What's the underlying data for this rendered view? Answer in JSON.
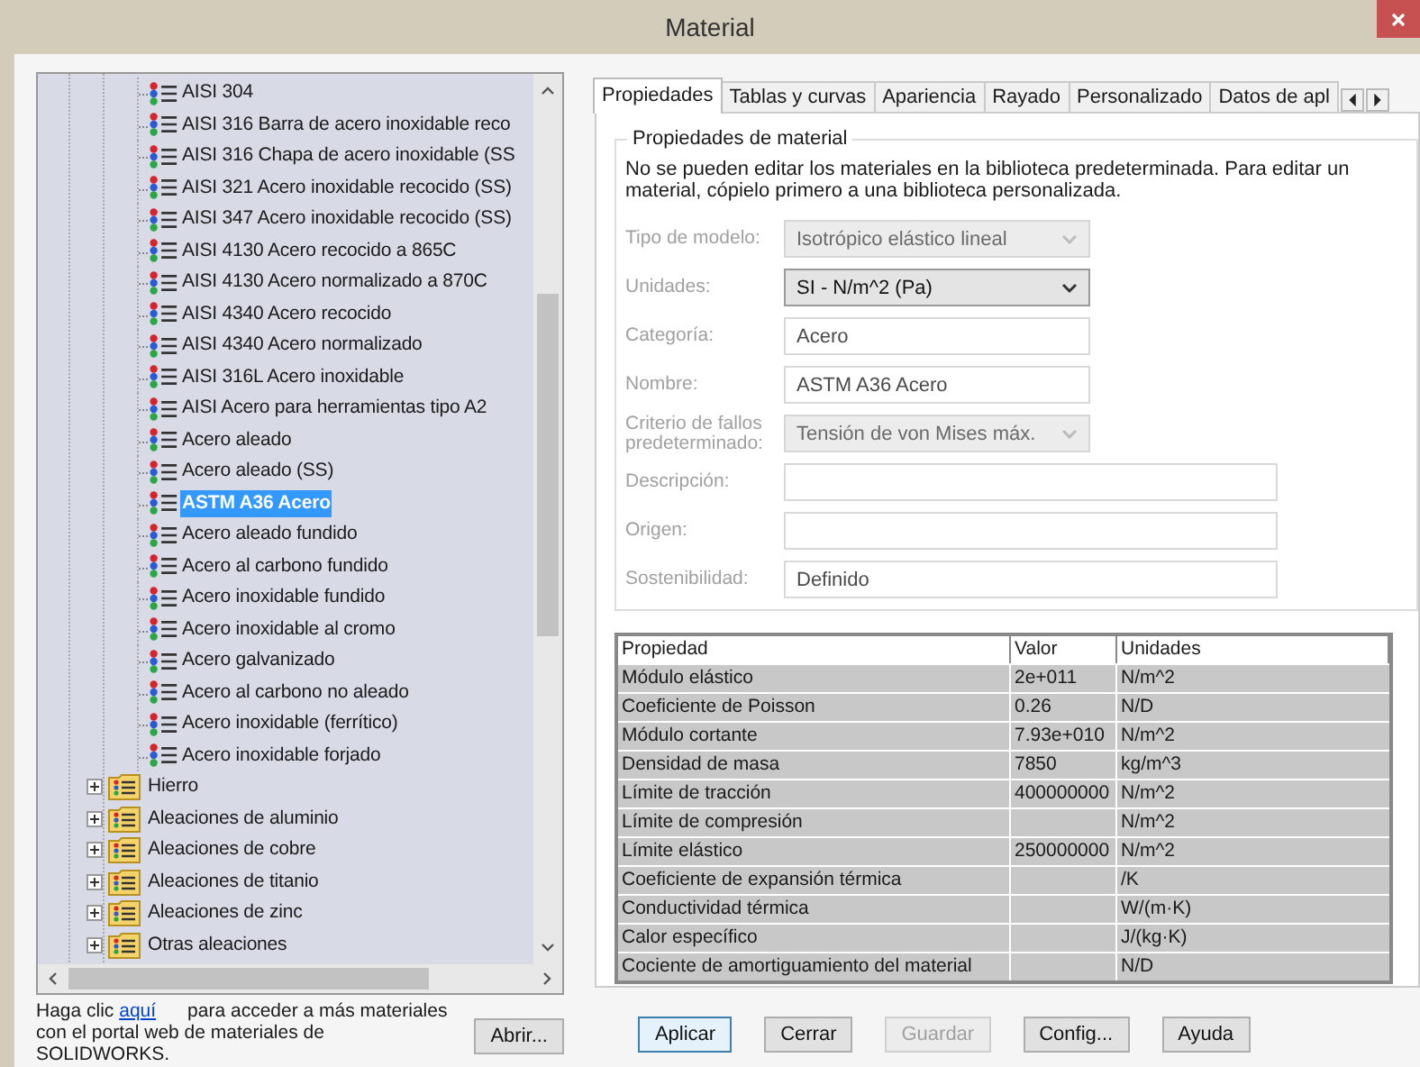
{
  "window": {
    "title": "Material"
  },
  "tree": {
    "open_group_items": [
      {
        "label": "AISI 304",
        "selected": false
      },
      {
        "label": "AISI 316 Barra de acero inoxidable reco",
        "selected": false
      },
      {
        "label": "AISI 316 Chapa de acero inoxidable (SS",
        "selected": false
      },
      {
        "label": "AISI 321 Acero inoxidable recocido (SS)",
        "selected": false
      },
      {
        "label": "AISI 347 Acero inoxidable recocido (SS)",
        "selected": false
      },
      {
        "label": "AISI 4130 Acero recocido a 865C",
        "selected": false
      },
      {
        "label": "AISI 4130 Acero normalizado a 870C",
        "selected": false
      },
      {
        "label": "AISI 4340 Acero recocido",
        "selected": false
      },
      {
        "label": "AISI 4340 Acero normalizado",
        "selected": false
      },
      {
        "label": "AISI 316L Acero inoxidable",
        "selected": false
      },
      {
        "label": "AISI Acero para herramientas tipo A2",
        "selected": false
      },
      {
        "label": "Acero aleado",
        "selected": false
      },
      {
        "label": "Acero aleado (SS)",
        "selected": false
      },
      {
        "label": "ASTM A36 Acero",
        "selected": true
      },
      {
        "label": "Acero aleado fundido",
        "selected": false
      },
      {
        "label": "Acero al carbono fundido",
        "selected": false
      },
      {
        "label": "Acero inoxidable fundido",
        "selected": false
      },
      {
        "label": "Acero inoxidable al cromo",
        "selected": false
      },
      {
        "label": "Acero galvanizado",
        "selected": false
      },
      {
        "label": "Acero al carbono no aleado",
        "selected": false
      },
      {
        "label": "Acero inoxidable (ferrítico)",
        "selected": false
      },
      {
        "label": "Acero inoxidable forjado",
        "selected": false
      }
    ],
    "folders": [
      {
        "label": "Hierro",
        "expanded": false
      },
      {
        "label": "Aleaciones de aluminio",
        "expanded": false
      },
      {
        "label": "Aleaciones de cobre",
        "expanded": false
      },
      {
        "label": "Aleaciones de titanio",
        "expanded": false
      },
      {
        "label": "Aleaciones de zinc",
        "expanded": false
      },
      {
        "label": "Otras aleaciones",
        "expanded": false
      }
    ]
  },
  "web_note": {
    "text_before": "Haga clic",
    "link": "aquí",
    "text_after": "para acceder a más materiales con el portal web de materiales de SOLIDWORKS.",
    "button": "Abrir..."
  },
  "tabs": [
    {
      "label": "Propiedades",
      "selected": true
    },
    {
      "label": "Tablas y curvas",
      "selected": false
    },
    {
      "label": "Apariencia",
      "selected": false
    },
    {
      "label": "Rayado",
      "selected": false
    },
    {
      "label": "Personalizado",
      "selected": false
    },
    {
      "label": "Datos de apl",
      "selected": false
    }
  ],
  "group": {
    "title": "Propiedades de material",
    "notice": "No se pueden editar los materiales en la biblioteca predeterminada. Para editar un material, cópielo primero a una biblioteca personalizada.",
    "fields": [
      {
        "label": "Tipo de modelo:",
        "kind": "select",
        "value": "Isotrópico elástico lineal",
        "disabled": true
      },
      {
        "label": "Unidades:",
        "kind": "select",
        "value": "SI - N/m^2 (Pa)",
        "disabled": false
      },
      {
        "label": "Categoría:",
        "kind": "text",
        "value": "Acero",
        "disabled": true
      },
      {
        "label": "Nombre:",
        "kind": "text",
        "value": "ASTM A36 Acero",
        "disabled": true
      },
      {
        "label": "Criterio de fallos predeterminado:",
        "kind": "select",
        "value": "Tensión de von Mises máx.",
        "disabled": true
      },
      {
        "label": "Descripción:",
        "kind": "widetext",
        "disabled": true
      },
      {
        "label": "Origen:",
        "kind": "widetext",
        "disabled": true
      },
      {
        "label": "Sostenibilidad:",
        "kind": "widetext",
        "value": "Definido",
        "disabled": true
      }
    ]
  },
  "table": {
    "columns": [
      "Propiedad",
      "Valor",
      "Unidades"
    ],
    "rows": [
      [
        "Módulo elástico",
        "2e+011",
        "N/m^2"
      ],
      [
        "Coeficiente de Poisson",
        "0.26",
        "N/D"
      ],
      [
        "Módulo cortante",
        "7.93e+010",
        "N/m^2"
      ],
      [
        "Densidad de masa",
        "7850",
        "kg/m^3"
      ],
      [
        "Límite de tracción",
        "400000000",
        "N/m^2"
      ],
      [
        "Límite de compresión",
        "",
        "N/m^2"
      ],
      [
        "Límite elástico",
        "250000000",
        "N/m^2"
      ],
      [
        "Coeficiente de expansión térmica",
        "",
        "/K"
      ],
      [
        "Conductividad térmica",
        "",
        "W/(m·K)"
      ],
      [
        "Calor específico",
        "",
        "J/(kg·K)"
      ],
      [
        "Cociente de amortiguamiento del material",
        "",
        "N/D"
      ]
    ]
  },
  "buttons": [
    {
      "label": "Aplicar",
      "default": true,
      "disabled": false
    },
    {
      "label": "Cerrar",
      "default": false,
      "disabled": false
    },
    {
      "label": "Guardar",
      "default": false,
      "disabled": true
    },
    {
      "label": "Config...",
      "default": false,
      "disabled": false
    },
    {
      "label": "Ayuda",
      "default": false,
      "disabled": false
    }
  ]
}
